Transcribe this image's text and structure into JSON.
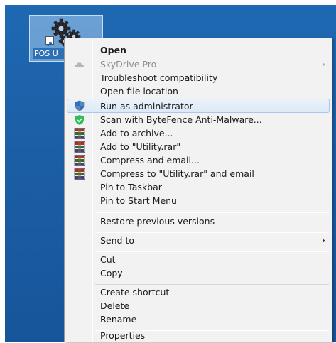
{
  "desktop": {
    "icon_label": "POS U"
  },
  "context_menu": {
    "items": [
      {
        "label": "Open"
      },
      {
        "label": "SkyDrive Pro"
      },
      {
        "label": "Troubleshoot compatibility"
      },
      {
        "label": "Open file location"
      },
      {
        "label": "Run as administrator"
      },
      {
        "label": "Scan with ByteFence Anti-Malware..."
      },
      {
        "label": "Add to archive..."
      },
      {
        "label": "Add to \"Utility.rar\""
      },
      {
        "label": "Compress and email..."
      },
      {
        "label": "Compress to \"Utility.rar\" and email"
      },
      {
        "label": "Pin to Taskbar"
      },
      {
        "label": "Pin to Start Menu"
      },
      {
        "label": "Restore previous versions"
      },
      {
        "label": "Send to"
      },
      {
        "label": "Cut"
      },
      {
        "label": "Copy"
      },
      {
        "label": "Create shortcut"
      },
      {
        "label": "Delete"
      },
      {
        "label": "Rename"
      },
      {
        "label": "Properties"
      }
    ]
  },
  "colors": {
    "desktop_blue": "#1c5fa6",
    "menu_bg": "#f2f2f2",
    "highlight_border": "#a8c8ea",
    "bytefence_green": "#2fbf5a",
    "winrar_red": "#b3262e"
  }
}
